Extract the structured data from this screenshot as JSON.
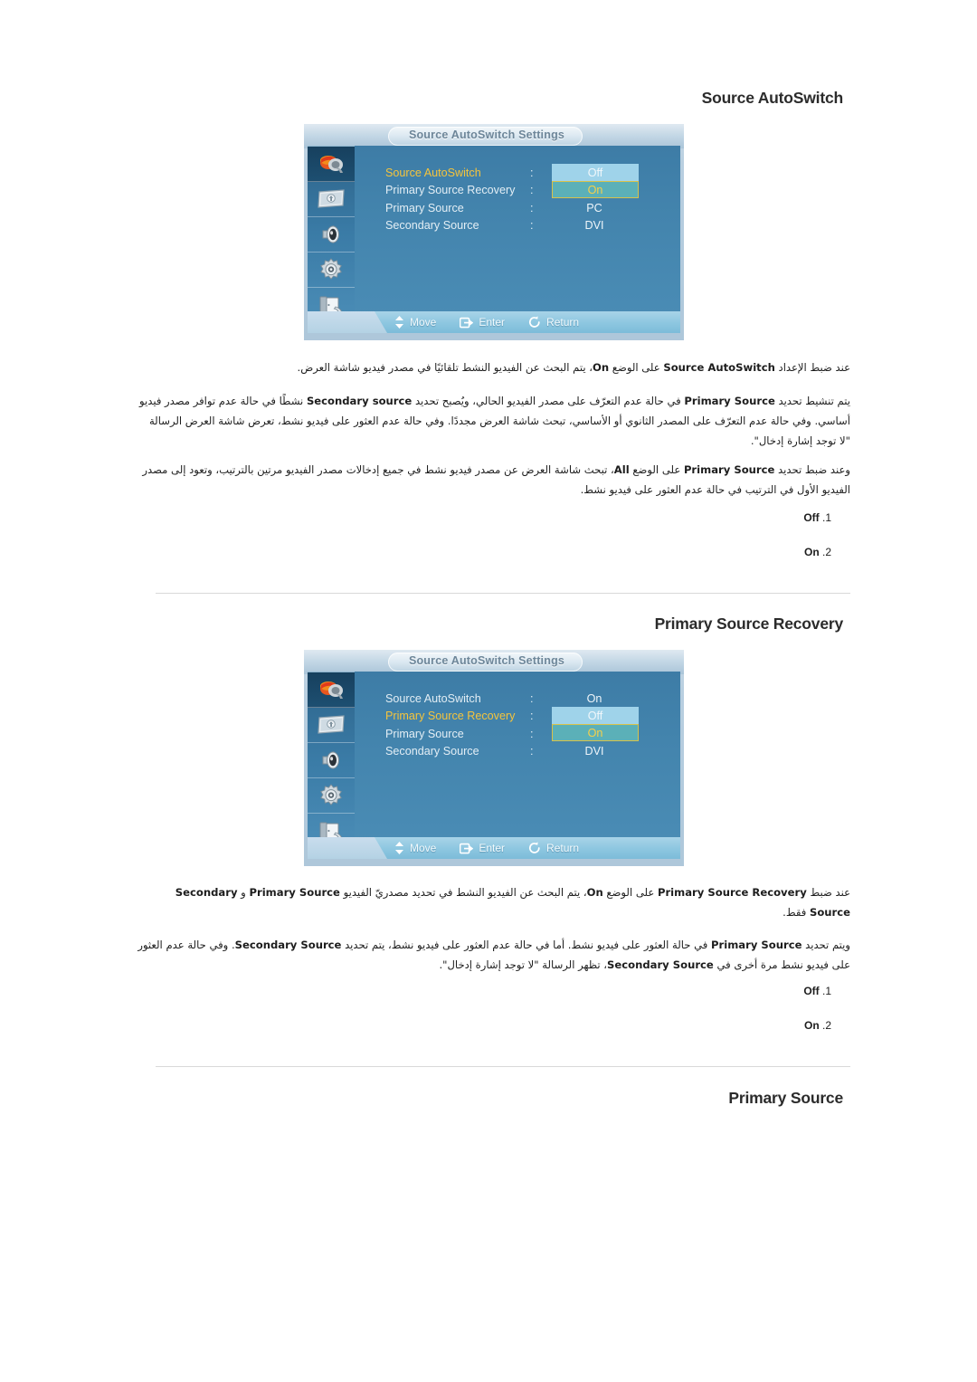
{
  "document": {
    "language": "ar",
    "page_background": "#ffffff"
  },
  "sections": [
    {
      "id": "source-autoswitch",
      "heading": "Source AutoSwitch",
      "osd": {
        "title": "Source AutoSwitch Settings",
        "rail_icons": [
          "picture-color-icon",
          "screen-adjust-icon",
          "sound-speaker-icon",
          "setup-gear-icon",
          "multi-control-exit-icon"
        ],
        "rows": [
          {
            "label": "Source AutoSwitch",
            "colon": ":",
            "value": "Off",
            "selected": true,
            "value_style": "plain"
          },
          {
            "label": "Primary Source Recovery",
            "colon": ":",
            "value": "On",
            "selected": false,
            "value_style": "selected"
          },
          {
            "label": "Primary Source",
            "colon": ":",
            "value": "PC",
            "selected": false,
            "value_style": "none"
          },
          {
            "label": "Secondary Source",
            "colon": ":",
            "value": "DVI",
            "selected": false,
            "value_style": "none"
          }
        ],
        "footer": [
          {
            "icon": "updown-arrow-icon",
            "label": "Move"
          },
          {
            "icon": "enter-icon",
            "label": "Enter"
          },
          {
            "icon": "return-icon",
            "label": "Return"
          }
        ]
      },
      "paragraphs": [
        "عند ضبط الإعداد <b>Source AutoSwitch</b> على الوضع <b>On</b>، يتم البحث عن الفيديو النشط تلقائيًا في مصدر فيديو شاشة العرض.",
        "يتم تنشيط تحديد <b>Primary Source</b> في حالة عدم التعرّف على مصدر الفيديو الحالي، ويُصبح تحديد <b>Secondary source</b> نشطًا في حالة عدم توافر مصدر فيديو أساسي. وفي حالة عدم التعرّف على المصدر الثانوي أو الأساسي، تبحث شاشة العرض مجددًا. وفي حالة عدم العثور على فيديو نشط، تعرض شاشة العرض الرسالة \"لا توجد إشارة إدخال\".",
        "وعند ضبط تحديد <b>Primary Source</b> على الوضع <b>All</b>، تبحث شاشة العرض عن مصدر فيديو نشط في جميع إدخالات مصدر الفيديو مرتين بالترتيب، وتعود إلى مصدر الفيديو الأول في الترتيب في حالة عدم العثور على فيديو نشط."
      ],
      "options": [
        {
          "num": ".1",
          "label": "Off"
        },
        {
          "num": ".2",
          "label": "On"
        }
      ]
    },
    {
      "id": "primary-source-recovery",
      "heading": "Primary Source Recovery",
      "osd": {
        "title": "Source AutoSwitch Settings",
        "rail_icons": [
          "picture-color-icon",
          "screen-adjust-icon",
          "sound-speaker-icon",
          "setup-gear-icon",
          "multi-control-exit-icon"
        ],
        "rows": [
          {
            "label": "Source AutoSwitch",
            "colon": ":",
            "value": "On",
            "selected": false,
            "value_style": "none"
          },
          {
            "label": "Primary Source Recovery",
            "colon": ":",
            "value": "Off",
            "selected": true,
            "value_style": "plain"
          },
          {
            "label": "Primary Source",
            "colon": ":",
            "value": "On",
            "selected": false,
            "value_style": "selected"
          },
          {
            "label": "Secondary Source",
            "colon": ":",
            "value": "DVI",
            "selected": false,
            "value_style": "none"
          }
        ],
        "footer": [
          {
            "icon": "updown-arrow-icon",
            "label": "Move"
          },
          {
            "icon": "enter-icon",
            "label": "Enter"
          },
          {
            "icon": "return-icon",
            "label": "Return"
          }
        ]
      },
      "paragraphs": [
        "عند ضبط <b>Primary Source Recovery</b> على الوضع <b>On</b>، يتم البحث عن الفيديو النشط في تحديد مصدريّ الفيديو <b>Primary Source</b> و <b>Secondary Source</b> فقط.",
        "ويتم تحديد <b>Primary Source</b> في حالة العثور على فيديو نشط. أما في حالة عدم العثور على فيديو نشط، يتم تحديد <b>Secondary Source</b>. وفي حالة عدم العثور على فيديو نشط مرة أخرى في <b>Secondary Source</b>، تظهر الرسالة \"لا توجد إشارة إدخال\"."
      ],
      "options": [
        {
          "num": ".1",
          "label": "Off"
        },
        {
          "num": ".2",
          "label": "On"
        }
      ]
    },
    {
      "id": "primary-source",
      "heading": "Primary Source",
      "osd": null,
      "paragraphs": [],
      "options": []
    }
  ]
}
